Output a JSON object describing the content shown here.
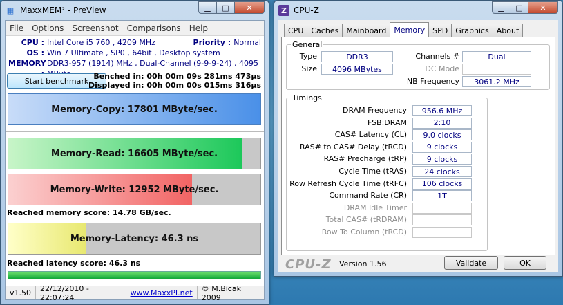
{
  "maxxmem": {
    "title": "MaxxMEM² - PreView",
    "menu": [
      "File",
      "Options",
      "Screenshot",
      "Comparisons",
      "Help"
    ],
    "cpu_label": "CPU :",
    "cpu_value": "Intel Core i5 760 , 4209 MHz",
    "priority_label": "Priority :",
    "priority_value": "Normal",
    "os_label": "OS :",
    "os_value": "Win 7 Ultimate , SP0 , 64bit , Desktop system",
    "memory_label": "MEMORY :",
    "memory_value": "DDR3-957 (1914) MHz , Dual-Channel (9-9-9-24) , 4095 MByte",
    "start_button": "Start benchmark",
    "benched": "Benched in: 00h 00m 09s 281ms 473µs",
    "displayed": "Displayed in: 00h 00m 00s 015ms 316µs",
    "bars": [
      {
        "label": "Memory-Copy: 17801 MByte/sec.",
        "fill_pct": 100,
        "color": "#c8dcf8",
        "color2": "#4a90e8"
      },
      {
        "label": "Memory-Read: 16605 MByte/sec.",
        "fill_pct": 93,
        "color": "#c8f5c8",
        "color2": "#1cc85a"
      },
      {
        "label": "Memory-Write: 12952 MByte/sec.",
        "fill_pct": 73,
        "color": "#fbd0d0",
        "color2": "#f26464"
      }
    ],
    "memory_score": "Reached memory score: 14.78 GB/sec.",
    "latency": {
      "label": "Memory-Latency: 46.3 ns",
      "fill_pct": 31
    },
    "latency_score": "Reached latency score: 46.3 ns",
    "status": {
      "version": "v1.50",
      "datetime": "22/12/2010 - 22:07:24",
      "link": "www.MaxxPI.net",
      "copyright": "© M.Bicak 2009"
    }
  },
  "cpuz": {
    "title": "CPU-Z",
    "icon_letter": "Z",
    "tabs": [
      "CPU",
      "Caches",
      "Mainboard",
      "Memory",
      "SPD",
      "Graphics",
      "About"
    ],
    "active_tab": "Memory",
    "general_title": "General",
    "type_label": "Type",
    "type_value": "DDR3",
    "size_label": "Size",
    "size_value": "4096 MBytes",
    "channels_label": "Channels #",
    "channels_value": "Dual",
    "dcmode_label": "DC Mode",
    "dcmode_value": "",
    "nbfreq_label": "NB Frequency",
    "nbfreq_value": "3061.2 MHz",
    "timings_title": "Timings",
    "timings": [
      {
        "label": "DRAM Frequency",
        "value": "956.6 MHz",
        "enabled": true
      },
      {
        "label": "FSB:DRAM",
        "value": "2:10",
        "enabled": true
      },
      {
        "label": "CAS# Latency (CL)",
        "value": "9.0 clocks",
        "enabled": true
      },
      {
        "label": "RAS# to CAS# Delay (tRCD)",
        "value": "9 clocks",
        "enabled": true
      },
      {
        "label": "RAS# Precharge (tRP)",
        "value": "9 clocks",
        "enabled": true
      },
      {
        "label": "Cycle Time (tRAS)",
        "value": "24 clocks",
        "enabled": true
      },
      {
        "label": "Row Refresh Cycle Time (tRFC)",
        "value": "106 clocks",
        "enabled": true
      },
      {
        "label": "Command Rate (CR)",
        "value": "1T",
        "enabled": true
      },
      {
        "label": "DRAM Idle Timer",
        "value": "",
        "enabled": false
      },
      {
        "label": "Total CAS# (tRDRAM)",
        "value": "",
        "enabled": false
      },
      {
        "label": "Row To Column (tRCD)",
        "value": "",
        "enabled": false
      }
    ],
    "logo": "CPU-Z",
    "version": "Version 1.56",
    "validate_button": "Validate",
    "ok_button": "OK"
  }
}
